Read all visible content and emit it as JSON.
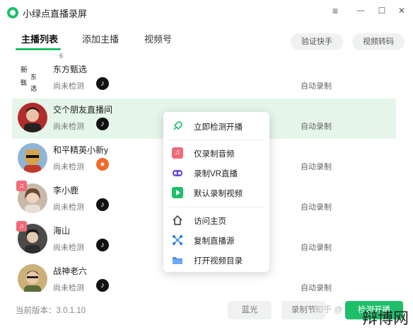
{
  "app": {
    "title": "小绿点直播录屏"
  },
  "window_controls": {
    "menu": "≡",
    "minimize": "—",
    "maximize": "☐",
    "close": "✕"
  },
  "tabs": [
    {
      "label": "主播列表",
      "count": "6"
    },
    {
      "label": "添加主播"
    },
    {
      "label": "视频号"
    }
  ],
  "actions": {
    "verify": "验证快手",
    "transcode": "视频转码"
  },
  "streamers": [
    {
      "name": "东方甄选",
      "status": "尚未检测",
      "platform": "douyin",
      "mode": "自动录制",
      "avatar_text": "新东方甄选"
    },
    {
      "name": "交个朋友直播间",
      "status": "尚未检测",
      "platform": "douyin",
      "mode": "自动录制"
    },
    {
      "name": "和平精英小新y",
      "status": "尚未检测",
      "platform": "kuaishou",
      "mode": "自动录制"
    },
    {
      "name": "李小鹿",
      "status": "尚未检测",
      "platform": "douyin",
      "mode": "自动录制"
    },
    {
      "name": "海山",
      "status": "尚未检测",
      "platform": "douyin",
      "mode": "自动录制"
    },
    {
      "name": "战神老六",
      "status": "尚未检测",
      "platform": "douyin",
      "mode": "自动录制"
    }
  ],
  "context_menu": {
    "items": [
      {
        "label": "立即检测开播",
        "icon": "rocket-icon"
      },
      {
        "label": "仅录制音频",
        "icon": "music-icon"
      },
      {
        "label": "录制VR直播",
        "icon": "vr-icon"
      },
      {
        "label": "默认录制视频",
        "icon": "video-icon"
      },
      {
        "label": "访问主页",
        "icon": "home-icon"
      },
      {
        "label": "复制直播源",
        "icon": "link-icon"
      },
      {
        "label": "打开视频目录",
        "icon": "folder-icon"
      }
    ]
  },
  "footer": {
    "version": "当前版本：3.0.1.10",
    "buttons": [
      "蓝光",
      "录制节",
      "检测开播"
    ]
  },
  "watermark": {
    "site": "知乎 @",
    "brand": "辩博网"
  },
  "colors": {
    "accent": "#1fbf6a",
    "selected_row": "#e5f5ea",
    "kuaishou": "#f26b2c",
    "music": "#f06b7a"
  }
}
